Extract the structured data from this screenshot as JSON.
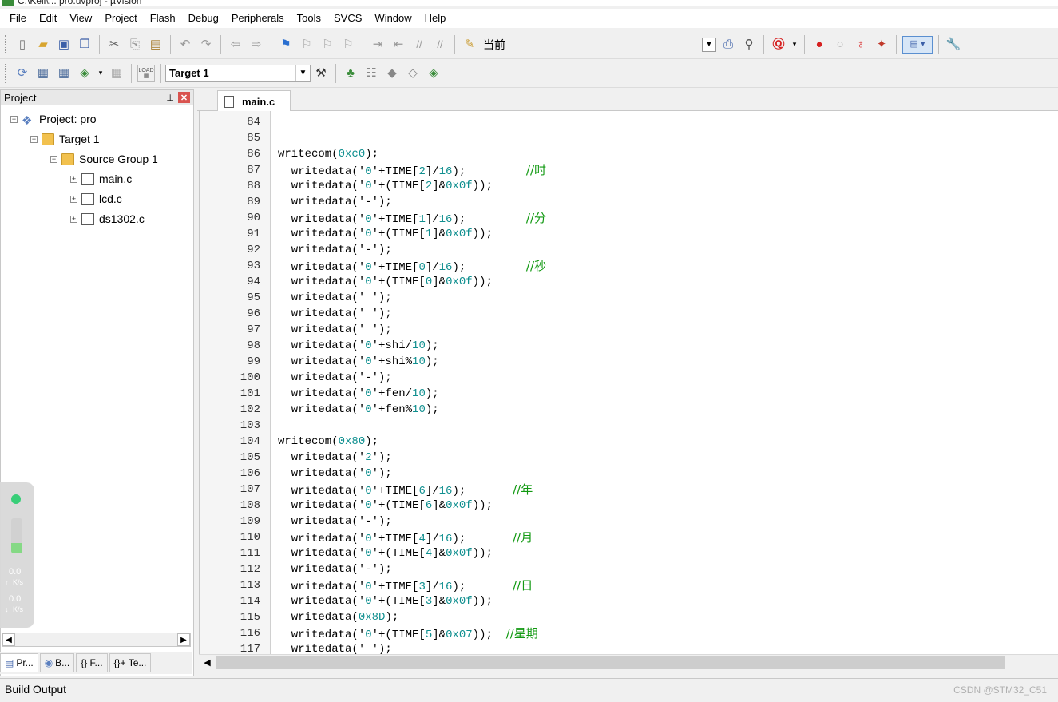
{
  "window": {
    "title": "C:\\Keil\\... pro.uvproj - µVision"
  },
  "menu": [
    "File",
    "Edit",
    "View",
    "Project",
    "Flash",
    "Debug",
    "Peripherals",
    "Tools",
    "SVCS",
    "Window",
    "Help"
  ],
  "toolbar1": {
    "current_label": "当前"
  },
  "toolbar2": {
    "load_label": "LOAD",
    "target_value": "Target 1"
  },
  "project_panel": {
    "title": "Project",
    "tree": [
      {
        "label": "Project: pro",
        "icon": "project-icon",
        "expand": "−"
      },
      {
        "label": "Target 1",
        "icon": "target-folder-icon",
        "expand": "−"
      },
      {
        "label": "Source Group 1",
        "icon": "folder-icon",
        "expand": "−"
      },
      {
        "label": "main.c",
        "icon": "file-icon",
        "expand": "+"
      },
      {
        "label": "lcd.c",
        "icon": "file-icon",
        "expand": "+"
      },
      {
        "label": "ds1302.c",
        "icon": "file-icon",
        "expand": "+"
      }
    ],
    "bottom_tabs": [
      "Pr...",
      "B...",
      "{} F...",
      "{}+ Te..."
    ]
  },
  "net_widget": {
    "up_value": "0.0",
    "up_unit": "K/s",
    "down_value": "0.0",
    "down_unit": "K/s",
    "level": 0.3
  },
  "editor": {
    "tab": "main.c",
    "lines": [
      {
        "n": "84",
        "code": ""
      },
      {
        "n": "85",
        "code": ""
      },
      {
        "n": "86",
        "code": "writecom(0xc0);"
      },
      {
        "n": "87",
        "code": "  writedata('0'+TIME[2]/16);         ",
        "comment": "//时"
      },
      {
        "n": "88",
        "code": "  writedata('0'+(TIME[2]&0x0f));"
      },
      {
        "n": "89",
        "code": "  writedata('-');"
      },
      {
        "n": "90",
        "code": "  writedata('0'+TIME[1]/16);         ",
        "comment": "//分"
      },
      {
        "n": "91",
        "code": "  writedata('0'+(TIME[1]&0x0f));"
      },
      {
        "n": "92",
        "code": "  writedata('-');"
      },
      {
        "n": "93",
        "code": "  writedata('0'+TIME[0]/16);         ",
        "comment": "//秒"
      },
      {
        "n": "94",
        "code": "  writedata('0'+(TIME[0]&0x0f));"
      },
      {
        "n": "95",
        "code": "  writedata(' ');"
      },
      {
        "n": "96",
        "code": "  writedata(' ');"
      },
      {
        "n": "97",
        "code": "  writedata(' ');"
      },
      {
        "n": "98",
        "code": "  writedata('0'+shi/10);"
      },
      {
        "n": "99",
        "code": "  writedata('0'+shi%10);"
      },
      {
        "n": "100",
        "code": "  writedata('-');"
      },
      {
        "n": "101",
        "code": "  writedata('0'+fen/10);"
      },
      {
        "n": "102",
        "code": "  writedata('0'+fen%10);"
      },
      {
        "n": "103",
        "code": ""
      },
      {
        "n": "104",
        "code": "writecom(0x80);"
      },
      {
        "n": "105",
        "code": "  writedata('2');"
      },
      {
        "n": "106",
        "code": "  writedata('0');"
      },
      {
        "n": "107",
        "code": "  writedata('0'+TIME[6]/16);       ",
        "comment": "//年"
      },
      {
        "n": "108",
        "code": "  writedata('0'+(TIME[6]&0x0f));"
      },
      {
        "n": "109",
        "code": "  writedata('-');"
      },
      {
        "n": "110",
        "code": "  writedata('0'+TIME[4]/16);       ",
        "comment": "//月"
      },
      {
        "n": "111",
        "code": "  writedata('0'+(TIME[4]&0x0f));"
      },
      {
        "n": "112",
        "code": "  writedata('-');"
      },
      {
        "n": "113",
        "code": "  writedata('0'+TIME[3]/16);       ",
        "comment": "//日"
      },
      {
        "n": "114",
        "code": "  writedata('0'+(TIME[3]&0x0f));"
      },
      {
        "n": "115",
        "code": "  writedata(0x8D);"
      },
      {
        "n": "116",
        "code": "  writedata('0'+(TIME[5]&0x07));  ",
        "comment": "//星期"
      },
      {
        "n": "117",
        "code": "  writedata(' ');"
      }
    ]
  },
  "build_output": {
    "label": "Build Output"
  },
  "watermark": "CSDN @STM32_C51",
  "colors": {
    "number": "#0f8f8f",
    "comment": "#119911",
    "breakpoint": "#d62020"
  }
}
